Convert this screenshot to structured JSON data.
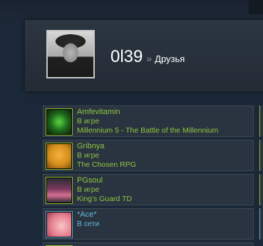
{
  "profile": {
    "username": "0l39",
    "separator": "»",
    "section": "Друзья"
  },
  "friends": [
    {
      "name": "Amfevitamin",
      "status": "В игре",
      "game": "Millennium 5 - The Battle of the Millennium",
      "state": "ingame",
      "avatar_icon": "fist-icon"
    },
    {
      "name": "Gribnya",
      "status": "В игре",
      "game": "The Chosen RPG",
      "state": "ingame",
      "avatar_icon": "character-icon"
    },
    {
      "name": "PGsoul",
      "status": "В игре",
      "game": "King's Guard TD",
      "state": "ingame",
      "avatar_icon": "character-icon"
    },
    {
      "name": "*Ace*",
      "status": "В сети",
      "state": "online",
      "avatar_icon": "character-icon"
    }
  ],
  "colors": {
    "background": "#1b2838",
    "ingame": "#8fc440",
    "online": "#62b8e3",
    "row_bg": "#2a3440"
  }
}
